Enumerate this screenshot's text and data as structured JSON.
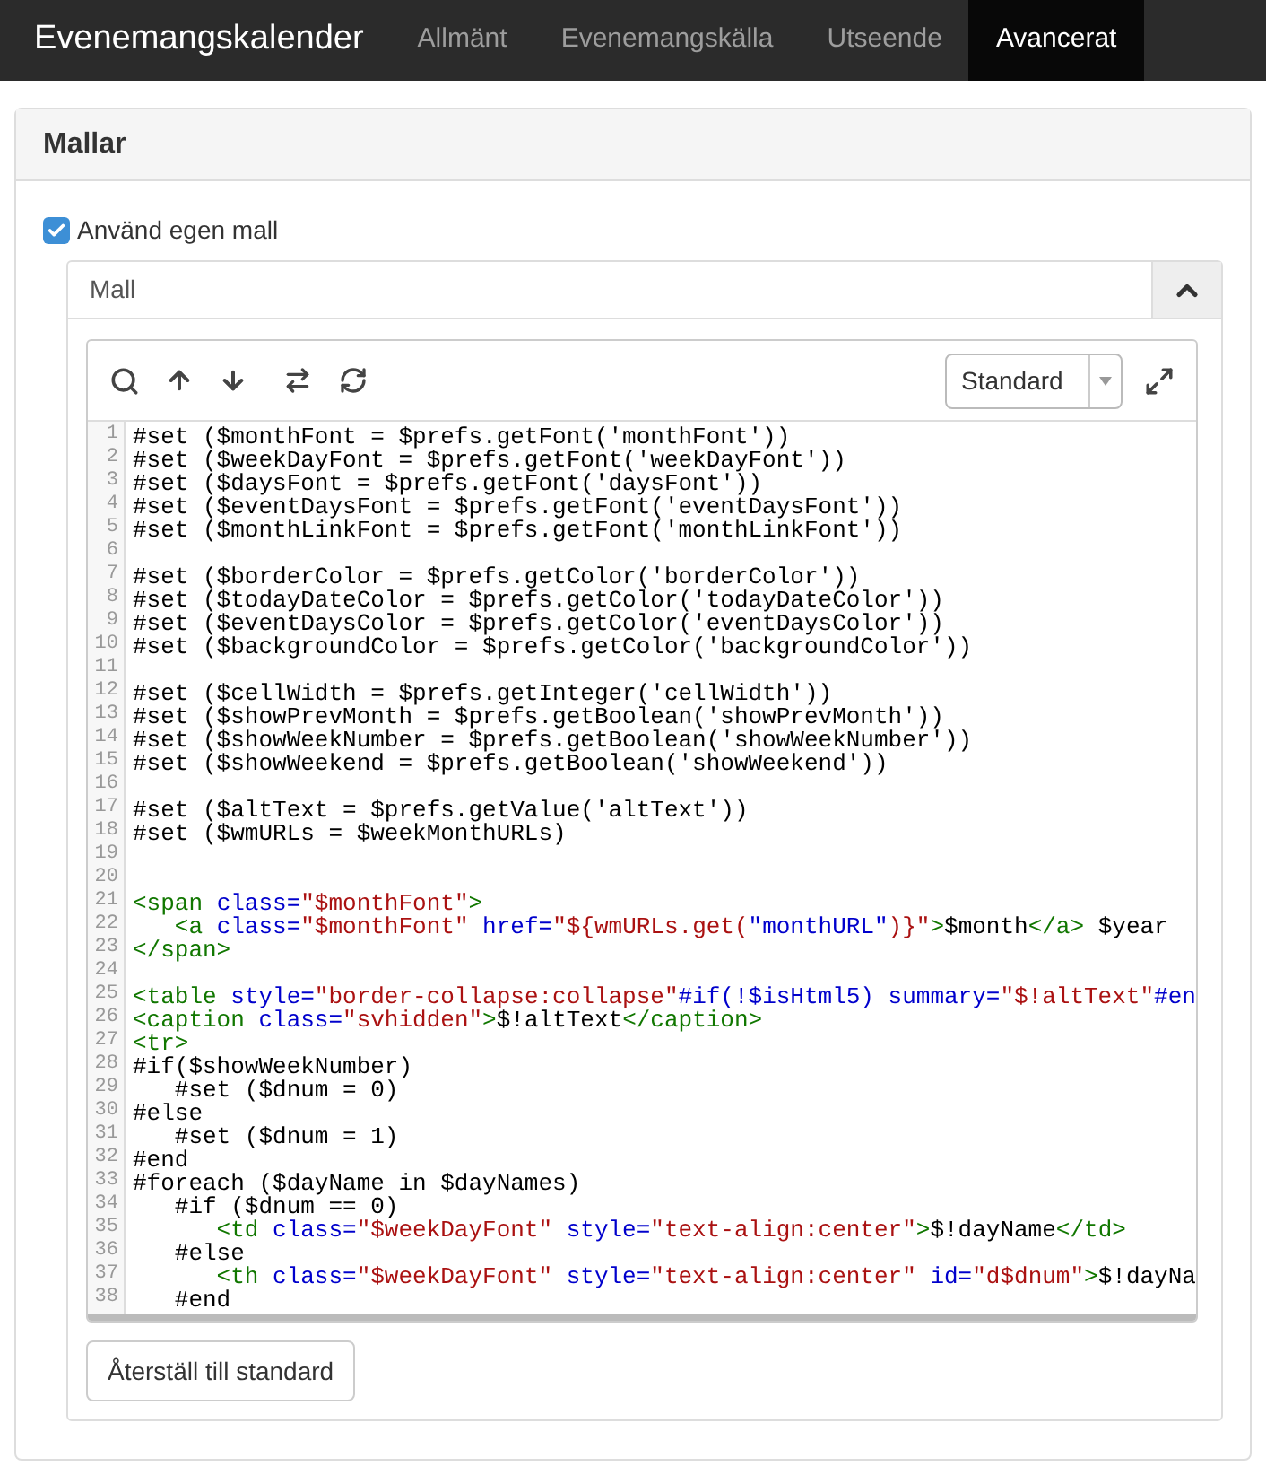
{
  "navbar": {
    "brand": "Evenemangskalender",
    "tabs": [
      {
        "label": "Allmänt",
        "selected": false
      },
      {
        "label": "Evenemangskälla",
        "selected": false
      },
      {
        "label": "Utseende",
        "selected": false
      },
      {
        "label": "Avancerat",
        "selected": true
      }
    ]
  },
  "panel": {
    "title": "Mallar",
    "checkbox": {
      "label": "Använd egen mall",
      "checked": true
    },
    "accordion": {
      "title": "Mall",
      "expanded": true,
      "editor": {
        "mode_select": "Standard",
        "lines": [
          {
            "number": "1",
            "tokens": [
              {
                "text": "#set ($monthFont = $prefs.getFont('monthFont'))",
                "color": "#000000"
              }
            ]
          },
          {
            "number": "2",
            "tokens": [
              {
                "text": "#set ($weekDayFont = $prefs.getFont('weekDayFont'))",
                "color": "#000000"
              }
            ]
          },
          {
            "number": "3",
            "tokens": [
              {
                "text": "#set ($daysFont = $prefs.getFont('daysFont'))",
                "color": "#000000"
              }
            ]
          },
          {
            "number": "4",
            "tokens": [
              {
                "text": "#set ($eventDaysFont = $prefs.getFont('eventDaysFont'))",
                "color": "#000000"
              }
            ]
          },
          {
            "number": "5",
            "tokens": [
              {
                "text": "#set ($monthLinkFont = $prefs.getFont('monthLinkFont'))",
                "color": "#000000"
              }
            ]
          },
          {
            "number": "6"
          },
          {
            "number": "7",
            "tokens": [
              {
                "text": "#set ($borderColor = $prefs.getColor('borderColor'))",
                "color": "#000000"
              }
            ]
          },
          {
            "number": "8",
            "tokens": [
              {
                "text": "#set ($todayDateColor = $prefs.getColor('todayDateColor'))",
                "color": "#000000"
              }
            ]
          },
          {
            "number": "9",
            "tokens": [
              {
                "text": "#set ($eventDaysColor = $prefs.getColor('eventDaysColor'))",
                "color": "#000000"
              }
            ]
          },
          {
            "number": "10",
            "tokens": [
              {
                "text": "#set ($backgroundColor = $prefs.getColor('backgroundColor'))",
                "color": "#000000"
              }
            ]
          },
          {
            "number": "11"
          },
          {
            "number": "12",
            "tokens": [
              {
                "text": "#set ($cellWidth = $prefs.getInteger('cellWidth'))",
                "color": "#000000"
              }
            ]
          },
          {
            "number": "13",
            "tokens": [
              {
                "text": "#set ($showPrevMonth = $prefs.getBoolean('showPrevMonth'))",
                "color": "#000000"
              }
            ]
          },
          {
            "number": "14",
            "tokens": [
              {
                "text": "#set ($showWeekNumber = $prefs.getBoolean('showWeekNumber'))",
                "color": "#000000"
              }
            ]
          },
          {
            "number": "15",
            "tokens": [
              {
                "text": "#set ($showWeekend = $prefs.getBoolean('showWeekend'))",
                "color": "#000000"
              }
            ]
          },
          {
            "number": "16"
          },
          {
            "number": "17",
            "tokens": [
              {
                "text": "#set ($altText = $prefs.getValue('altText'))",
                "color": "#000000"
              }
            ]
          },
          {
            "number": "18",
            "tokens": [
              {
                "text": "#set ($wmURLs = $weekMonthURLs)",
                "color": "#000000"
              }
            ]
          },
          {
            "number": "19"
          },
          {
            "number": "20"
          },
          {
            "number": "21",
            "tokens": [
              {
                "text": "<span",
                "color": "#117700"
              },
              {
                "text": " class=",
                "color": "#0000cc"
              },
              {
                "text": "\"$monthFont\"",
                "color": "#aa1111"
              },
              {
                "text": ">",
                "color": "#117700"
              }
            ]
          },
          {
            "number": "22",
            "tokens": [
              {
                "text": "   <a",
                "color": "#117700"
              },
              {
                "text": " class=",
                "color": "#0000cc"
              },
              {
                "text": "\"$monthFont\"",
                "color": "#aa1111"
              },
              {
                "text": " href=",
                "color": "#0000cc"
              },
              {
                "text": "\"${wmURLs.get(",
                "color": "#aa1111"
              },
              {
                "text": "\"monthURL\"",
                "color": "#0000cc"
              },
              {
                "text": ")}\"",
                "color": "#aa1111"
              },
              {
                "text": ">",
                "color": "#117700"
              },
              {
                "text": "$month",
                "color": "#000000"
              },
              {
                "text": "</a>",
                "color": "#117700"
              },
              {
                "text": " $year",
                "color": "#000000"
              }
            ]
          },
          {
            "number": "23",
            "tokens": [
              {
                "text": "</span>",
                "color": "#117700"
              }
            ]
          },
          {
            "number": "24"
          },
          {
            "number": "25",
            "tokens": [
              {
                "text": "<table",
                "color": "#117700"
              },
              {
                "text": " style=",
                "color": "#0000cc"
              },
              {
                "text": "\"border-collapse:collapse\"",
                "color": "#aa1111"
              },
              {
                "text": "#if(!$isHtml5) summary=",
                "color": "#0000cc"
              },
              {
                "text": "\"$!altText\"",
                "color": "#aa1111"
              },
              {
                "text": "#en",
                "color": "#0000cc"
              }
            ]
          },
          {
            "number": "26",
            "tokens": [
              {
                "text": "<caption",
                "color": "#117700"
              },
              {
                "text": " class=",
                "color": "#0000cc"
              },
              {
                "text": "\"svhidden\"",
                "color": "#aa1111"
              },
              {
                "text": ">",
                "color": "#117700"
              },
              {
                "text": "$!altText",
                "color": "#000000"
              },
              {
                "text": "</caption>",
                "color": "#117700"
              }
            ]
          },
          {
            "number": "27",
            "tokens": [
              {
                "text": "<tr>",
                "color": "#117700"
              }
            ]
          },
          {
            "number": "28",
            "tokens": [
              {
                "text": "#if($showWeekNumber)",
                "color": "#000000"
              }
            ]
          },
          {
            "number": "29",
            "tokens": [
              {
                "text": "   #set ($dnum = 0)",
                "color": "#000000"
              }
            ]
          },
          {
            "number": "30",
            "tokens": [
              {
                "text": "#else",
                "color": "#000000"
              }
            ]
          },
          {
            "number": "31",
            "tokens": [
              {
                "text": "   #set ($dnum = 1)",
                "color": "#000000"
              }
            ]
          },
          {
            "number": "32",
            "tokens": [
              {
                "text": "#end",
                "color": "#000000"
              }
            ]
          },
          {
            "number": "33",
            "tokens": [
              {
                "text": "#foreach ($dayName in $dayNames)",
                "color": "#000000"
              }
            ]
          },
          {
            "number": "34",
            "tokens": [
              {
                "text": "   #if ($dnum == 0)",
                "color": "#000000"
              }
            ]
          },
          {
            "number": "35",
            "tokens": [
              {
                "text": "      <td",
                "color": "#117700"
              },
              {
                "text": " class=",
                "color": "#0000cc"
              },
              {
                "text": "\"$weekDayFont\"",
                "color": "#aa1111"
              },
              {
                "text": " style=",
                "color": "#0000cc"
              },
              {
                "text": "\"text-align:center\"",
                "color": "#aa1111"
              },
              {
                "text": ">",
                "color": "#117700"
              },
              {
                "text": "$!dayName",
                "color": "#000000"
              },
              {
                "text": "</td>",
                "color": "#117700"
              }
            ]
          },
          {
            "number": "36",
            "tokens": [
              {
                "text": "   #else",
                "color": "#000000"
              }
            ]
          },
          {
            "number": "37",
            "tokens": [
              {
                "text": "      <th",
                "color": "#117700"
              },
              {
                "text": " class=",
                "color": "#0000cc"
              },
              {
                "text": "\"$weekDayFont\"",
                "color": "#aa1111"
              },
              {
                "text": " style=",
                "color": "#0000cc"
              },
              {
                "text": "\"text-align:center\"",
                "color": "#aa1111"
              },
              {
                "text": " id=",
                "color": "#0000cc"
              },
              {
                "text": "\"d$dnum\"",
                "color": "#aa1111"
              },
              {
                "text": ">",
                "color": "#117700"
              },
              {
                "text": "$!dayNa",
                "color": "#000000"
              }
            ]
          },
          {
            "number": "38",
            "tokens": [
              {
                "text": "   #end",
                "color": "#000000"
              }
            ]
          }
        ]
      },
      "reset_button": "Återställ till standard"
    }
  }
}
